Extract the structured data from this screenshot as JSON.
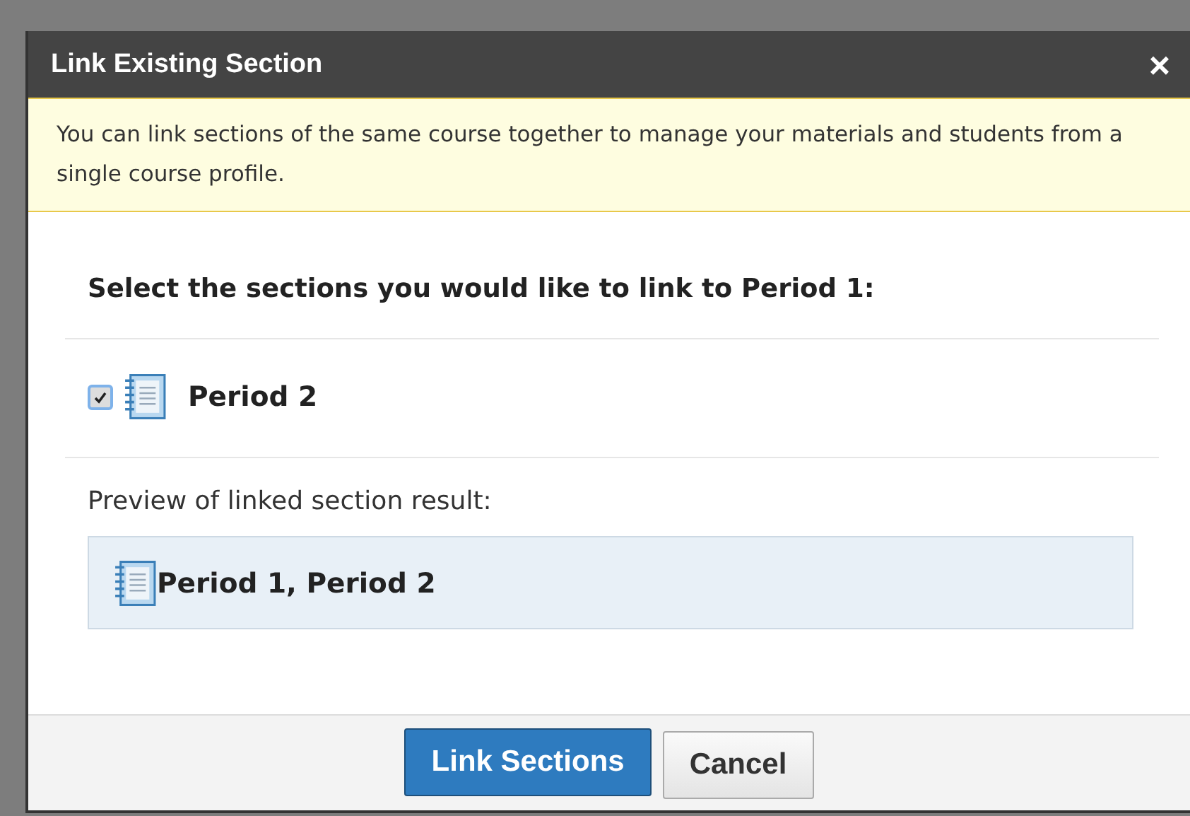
{
  "dialog": {
    "title": "Link Existing Section",
    "close": "×"
  },
  "notice": "You can link sections of the same course together to manage your materials and students from a single course profile.",
  "heading": "Select the sections you would like to link to Period 1:",
  "sections": [
    {
      "name": "Period 2",
      "checked": true
    }
  ],
  "preview": {
    "label": "Preview of linked section result:",
    "result": "Period 1, Period 2"
  },
  "buttons": [
    {
      "label": "Link Sections",
      "kind": "primary"
    },
    {
      "label": "Cancel",
      "kind": "secondary"
    }
  ]
}
